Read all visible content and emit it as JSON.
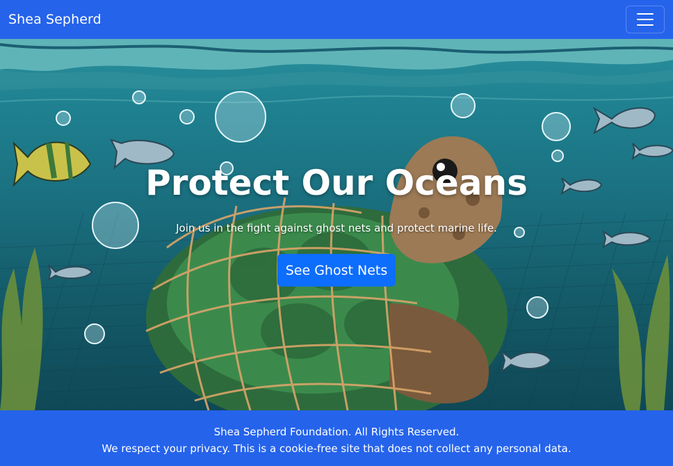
{
  "navbar": {
    "brand": "Shea Sepherd",
    "menu_icon": "hamburger-menu-icon"
  },
  "hero": {
    "title": "Protect Our Oceans",
    "subtitle": "Join us in the fight against ghost nets and protect marine life.",
    "button_label": "See Ghost Nets",
    "background_image": "illustration of a sea turtle entangled in a ghost net among fish, bubbles and seaweed"
  },
  "footer": {
    "line1": "Shea Sepherd Foundation. All Rights Reserved.",
    "line2": "We respect your privacy. This is a cookie-free site that does not collect any personal data."
  },
  "colors": {
    "nav_bg": "#2563eb",
    "footer_bg": "#2563eb",
    "button_bg": "#0d6efd",
    "text": "#ffffff"
  }
}
